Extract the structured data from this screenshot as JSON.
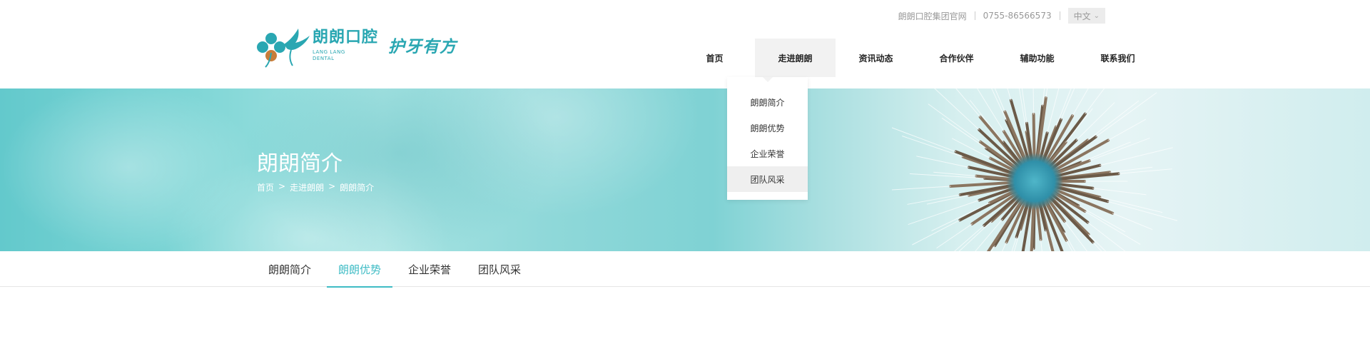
{
  "header": {
    "logo": {
      "name_cn": "朗朗口腔",
      "name_en_line1": "LANG LANG",
      "name_en_line2": "DENTAL",
      "slogan": "护牙有方"
    },
    "topbar": {
      "group_site": "朗朗口腔集团官网",
      "phone": "0755-86566573",
      "language": "中文"
    },
    "nav": [
      {
        "label": "首页"
      },
      {
        "label": "走进朗朗"
      },
      {
        "label": "资讯动态"
      },
      {
        "label": "合作伙伴"
      },
      {
        "label": "辅助功能"
      },
      {
        "label": "联系我们"
      }
    ]
  },
  "dropdown": {
    "items": [
      {
        "label": "朗朗简介"
      },
      {
        "label": "朗朗优势"
      },
      {
        "label": "企业荣誉"
      },
      {
        "label": "团队风采"
      }
    ]
  },
  "banner": {
    "title": "朗朗简介",
    "breadcrumb": {
      "home": "首页",
      "sep": ">",
      "section": "走进朗朗",
      "current": "朗朗简介"
    }
  },
  "subnav": {
    "tabs": [
      {
        "label": "朗朗简介"
      },
      {
        "label": "朗朗优势"
      },
      {
        "label": "企业荣誉"
      },
      {
        "label": "团队风采"
      }
    ],
    "active_index": 1
  },
  "colors": {
    "brand": "#2aa7b2",
    "accent": "#3fbcc5",
    "nav_active_bg": "#f2f2f2"
  }
}
